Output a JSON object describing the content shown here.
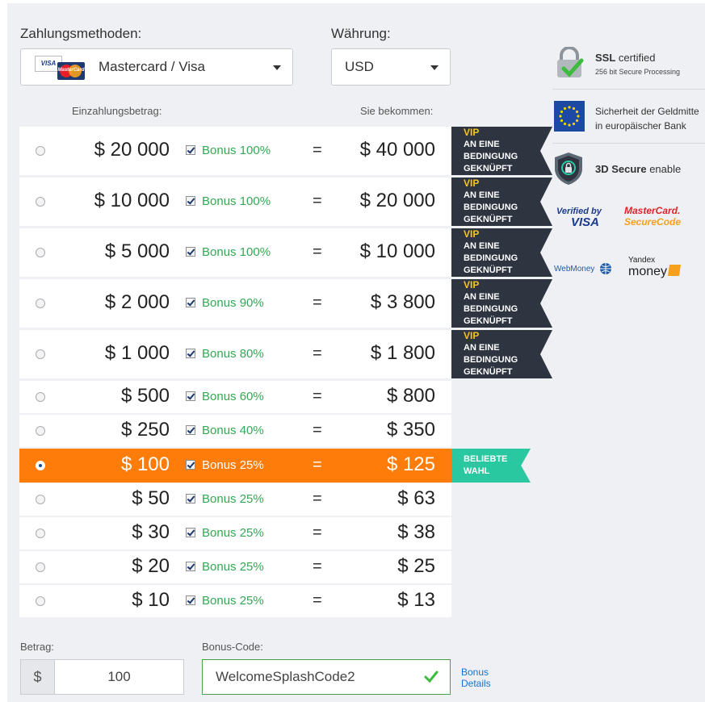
{
  "payment": {
    "methods_label": "Zahlungsmethoden:",
    "method_value": "Mastercard / Visa",
    "currency_label": "Währung:",
    "currency_value": "USD",
    "visa_mark": "VISA",
    "mc_mark": "MasterCard"
  },
  "table": {
    "deposit_header": "Einzahlungsbetrag:",
    "receive_header": "Sie bekommen:",
    "rows": [
      {
        "amount": "$ 20 000",
        "bonus": "Bonus 100%",
        "eq": "=",
        "get": "$ 40 000",
        "selected": false
      },
      {
        "amount": "$ 10 000",
        "bonus": "Bonus 100%",
        "eq": "=",
        "get": "$ 20 000",
        "selected": false
      },
      {
        "amount": "$ 5 000",
        "bonus": "Bonus 100%",
        "eq": "=",
        "get": "$ 10 000",
        "selected": false
      },
      {
        "amount": "$ 2 000",
        "bonus": "Bonus 90%",
        "eq": "=",
        "get": "$ 3 800",
        "selected": false
      },
      {
        "amount": "$ 1 000",
        "bonus": "Bonus 80%",
        "eq": "=",
        "get": "$ 1 800",
        "selected": false
      },
      {
        "amount": "$ 500",
        "bonus": "Bonus 60%",
        "eq": "=",
        "get": "$ 800",
        "selected": false
      },
      {
        "amount": "$ 250",
        "bonus": "Bonus 40%",
        "eq": "=",
        "get": "$ 350",
        "selected": false
      },
      {
        "amount": "$ 100",
        "bonus": "Bonus 25%",
        "eq": "=",
        "get": "$ 125",
        "selected": true
      },
      {
        "amount": "$ 50",
        "bonus": "Bonus 25%",
        "eq": "=",
        "get": "$ 63",
        "selected": false
      },
      {
        "amount": "$ 30",
        "bonus": "Bonus 25%",
        "eq": "=",
        "get": "$ 38",
        "selected": false
      },
      {
        "amount": "$ 20",
        "bonus": "Bonus 25%",
        "eq": "=",
        "get": "$ 25",
        "selected": false
      },
      {
        "amount": "$ 10",
        "bonus": "Bonus 25%",
        "eq": "=",
        "get": "$ 13",
        "selected": false
      }
    ],
    "vip": {
      "title": "VIP",
      "line1": "AN EINE",
      "line2": "BEDINGUNG",
      "line3": "GEKNÜPFT"
    },
    "popular": {
      "line1": "BELIEBTE",
      "line2": "WAHL"
    }
  },
  "security": {
    "ssl_title": "SSL",
    "ssl_suffix": " certified",
    "ssl_sub": "256 bit Secure Processing",
    "eu_line1": "Sicherheit der Geldmitte",
    "eu_line2": "in europäischer Bank",
    "secure3d_bold": "3D Secure",
    "secure3d_rest": " enable",
    "verified_by": "Verified by",
    "visa": "VISA",
    "mc_secure1": "MasterCard.",
    "mc_secure2": "SecureCode",
    "webmoney": "WebMoney",
    "yandex1": "Yandex",
    "yandex2": "money"
  },
  "footer": {
    "amount_label": "Betrag:",
    "currency_symbol": "$",
    "amount_value": "100",
    "bonus_label": "Bonus-Code:",
    "bonus_value": "WelcomeSplashCode2",
    "bonus_details_1": "Bonus",
    "bonus_details_2": "Details"
  },
  "colors": {
    "selected_row": "#fd7c0a",
    "bonus_green": "#34a853",
    "vip_bg": "#2e3440",
    "popular_bg": "#2ac8a0",
    "link": "#1a73c9"
  }
}
